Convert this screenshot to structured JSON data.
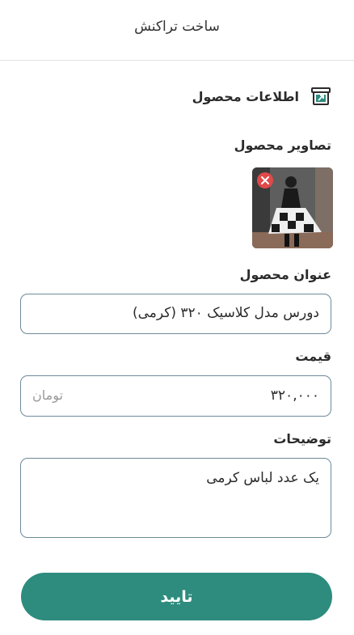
{
  "header": {
    "title": "ساخت تراکنش"
  },
  "section": {
    "title": "اطلاعات محصول",
    "icon": "box-arrow-icon"
  },
  "images": {
    "label": "تصاویر محصول",
    "remove_icon": "close-icon"
  },
  "product_title": {
    "label": "عنوان محصول",
    "value": "دورس مدل کلاسیک ۳۲۰ (کرمی)"
  },
  "price": {
    "label": "قیمت",
    "value": "۳۲۰,۰۰۰",
    "unit": "تومان"
  },
  "description": {
    "label": "توضیحات",
    "value": "یک عدد لباس کرمی"
  },
  "confirm": {
    "label": "تایید"
  },
  "colors": {
    "accent": "#2e8c7e",
    "field_border": "#6e8a9a",
    "remove": "#e0494a"
  }
}
